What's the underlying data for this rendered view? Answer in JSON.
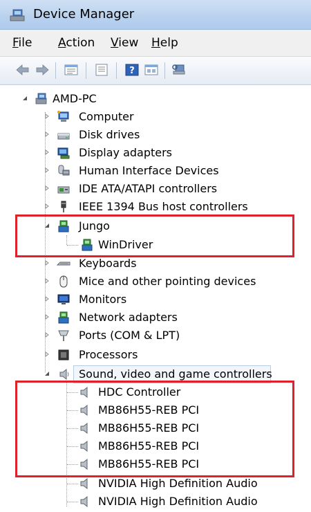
{
  "window": {
    "title": "Device Manager"
  },
  "menu": {
    "items": [
      {
        "label": "File",
        "accel": "F",
        "rest": "ile"
      },
      {
        "label": "Action",
        "accel": "A",
        "rest": "ction"
      },
      {
        "label": "View",
        "accel": "V",
        "rest": "iew"
      },
      {
        "label": "Help",
        "accel": "H",
        "rest": "elp"
      }
    ]
  },
  "toolbar": {
    "buttons": [
      "back-icon",
      "forward-icon",
      "properties-icon",
      "console-icon",
      "help-icon",
      "view-icon",
      "scan-hardware-icon"
    ]
  },
  "tree": {
    "root": "AMD-PC",
    "nodes": [
      {
        "label": "Computer",
        "icon": "computer-icon"
      },
      {
        "label": "Disk drives",
        "icon": "disk-drive-icon"
      },
      {
        "label": "Display adapters",
        "icon": "display-adapter-icon"
      },
      {
        "label": "Human Interface Devices",
        "icon": "hid-icon"
      },
      {
        "label": "IDE ATA/ATAPI controllers",
        "icon": "ide-controller-icon"
      },
      {
        "label": "IEEE 1394 Bus host controllers",
        "icon": "ieee1394-icon"
      },
      {
        "label": "Jungo",
        "icon": "jungo-icon",
        "expanded": true,
        "children": [
          {
            "label": "WinDriver",
            "icon": "windriver-icon"
          }
        ]
      },
      {
        "label": "Keyboards",
        "icon": "keyboard-icon"
      },
      {
        "label": "Mice and other pointing devices",
        "icon": "mouse-icon"
      },
      {
        "label": "Monitors",
        "icon": "monitor-icon"
      },
      {
        "label": "Network adapters",
        "icon": "network-adapter-icon"
      },
      {
        "label": "Ports (COM & LPT)",
        "icon": "port-icon"
      },
      {
        "label": "Processors",
        "icon": "processor-icon"
      },
      {
        "label": "Sound, video and game controllers",
        "icon": "sound-icon",
        "expanded": true,
        "selected": true,
        "children": [
          {
            "label": "HDC Controller",
            "icon": "speaker-icon"
          },
          {
            "label": "MB86H55-REB PCI",
            "icon": "speaker-icon"
          },
          {
            "label": "MB86H55-REB PCI",
            "icon": "speaker-icon"
          },
          {
            "label": "MB86H55-REB PCI",
            "icon": "speaker-icon"
          },
          {
            "label": "MB86H55-REB PCI",
            "icon": "speaker-icon"
          },
          {
            "label": "NVIDIA High Definition Audio",
            "icon": "speaker-icon"
          },
          {
            "label": "NVIDIA High Definition Audio",
            "icon": "speaker-icon"
          }
        ]
      }
    ]
  },
  "colors": {
    "highlight_box": "#e0202a",
    "selection_border": "#b6cde6"
  }
}
